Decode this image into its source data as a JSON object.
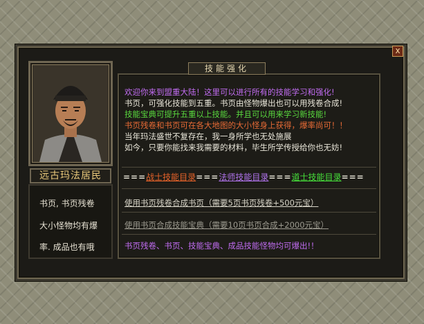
{
  "dialog": {
    "title": "技能强化",
    "close_label": "x",
    "npc_name": "远古玛法居民"
  },
  "left_items": [
    "书页, 书页残卷",
    "大小怪物均有爆",
    "率. 成品也有哦"
  ],
  "intro_lines": [
    {
      "text": "欢迎你来到盟重大陆！这里可以进行所有的技能学习和强化!",
      "color": "purple"
    },
    {
      "text": "书页，可强化技能到五重。书页由怪物爆出也可以用残卷合成!",
      "color": "white"
    },
    {
      "text": "技能宝典可提升五重以上技能。并且可以用来学习新技能!",
      "color": "green"
    },
    {
      "text": "书页残卷和书页可在各大地图的大小怪身上获得，爆率尚可！！",
      "color": "orange"
    },
    {
      "text": "当年玛法盛世不复存在，我一身所学也无处施展",
      "color": "white"
    },
    {
      "text": "如今，只要你能找来我需要的材料，毕生所学传授给你也无妨!",
      "color": "white"
    }
  ],
  "nav": {
    "eq1": "===",
    "warrior": "战士技能目录",
    "eq2": "===",
    "mage": "法师技能目录",
    "eq3": "===",
    "taoist": "道士技能目录",
    "eq4": "==="
  },
  "actions": {
    "craft_page": "使用书页残卷合成书页（需要5页书页残卷+500元宝）",
    "craft_book": "使用书页合成技能宝典（需要10页书页合成+2000元宝）"
  },
  "footer_text": "书页残卷、书页、技能宝典、成品技能怪物均可爆出!！",
  "colors": {
    "white": "#e8e5d8",
    "purple": "#c06cf0",
    "green": "#59d83e",
    "orange": "#e66a35"
  }
}
